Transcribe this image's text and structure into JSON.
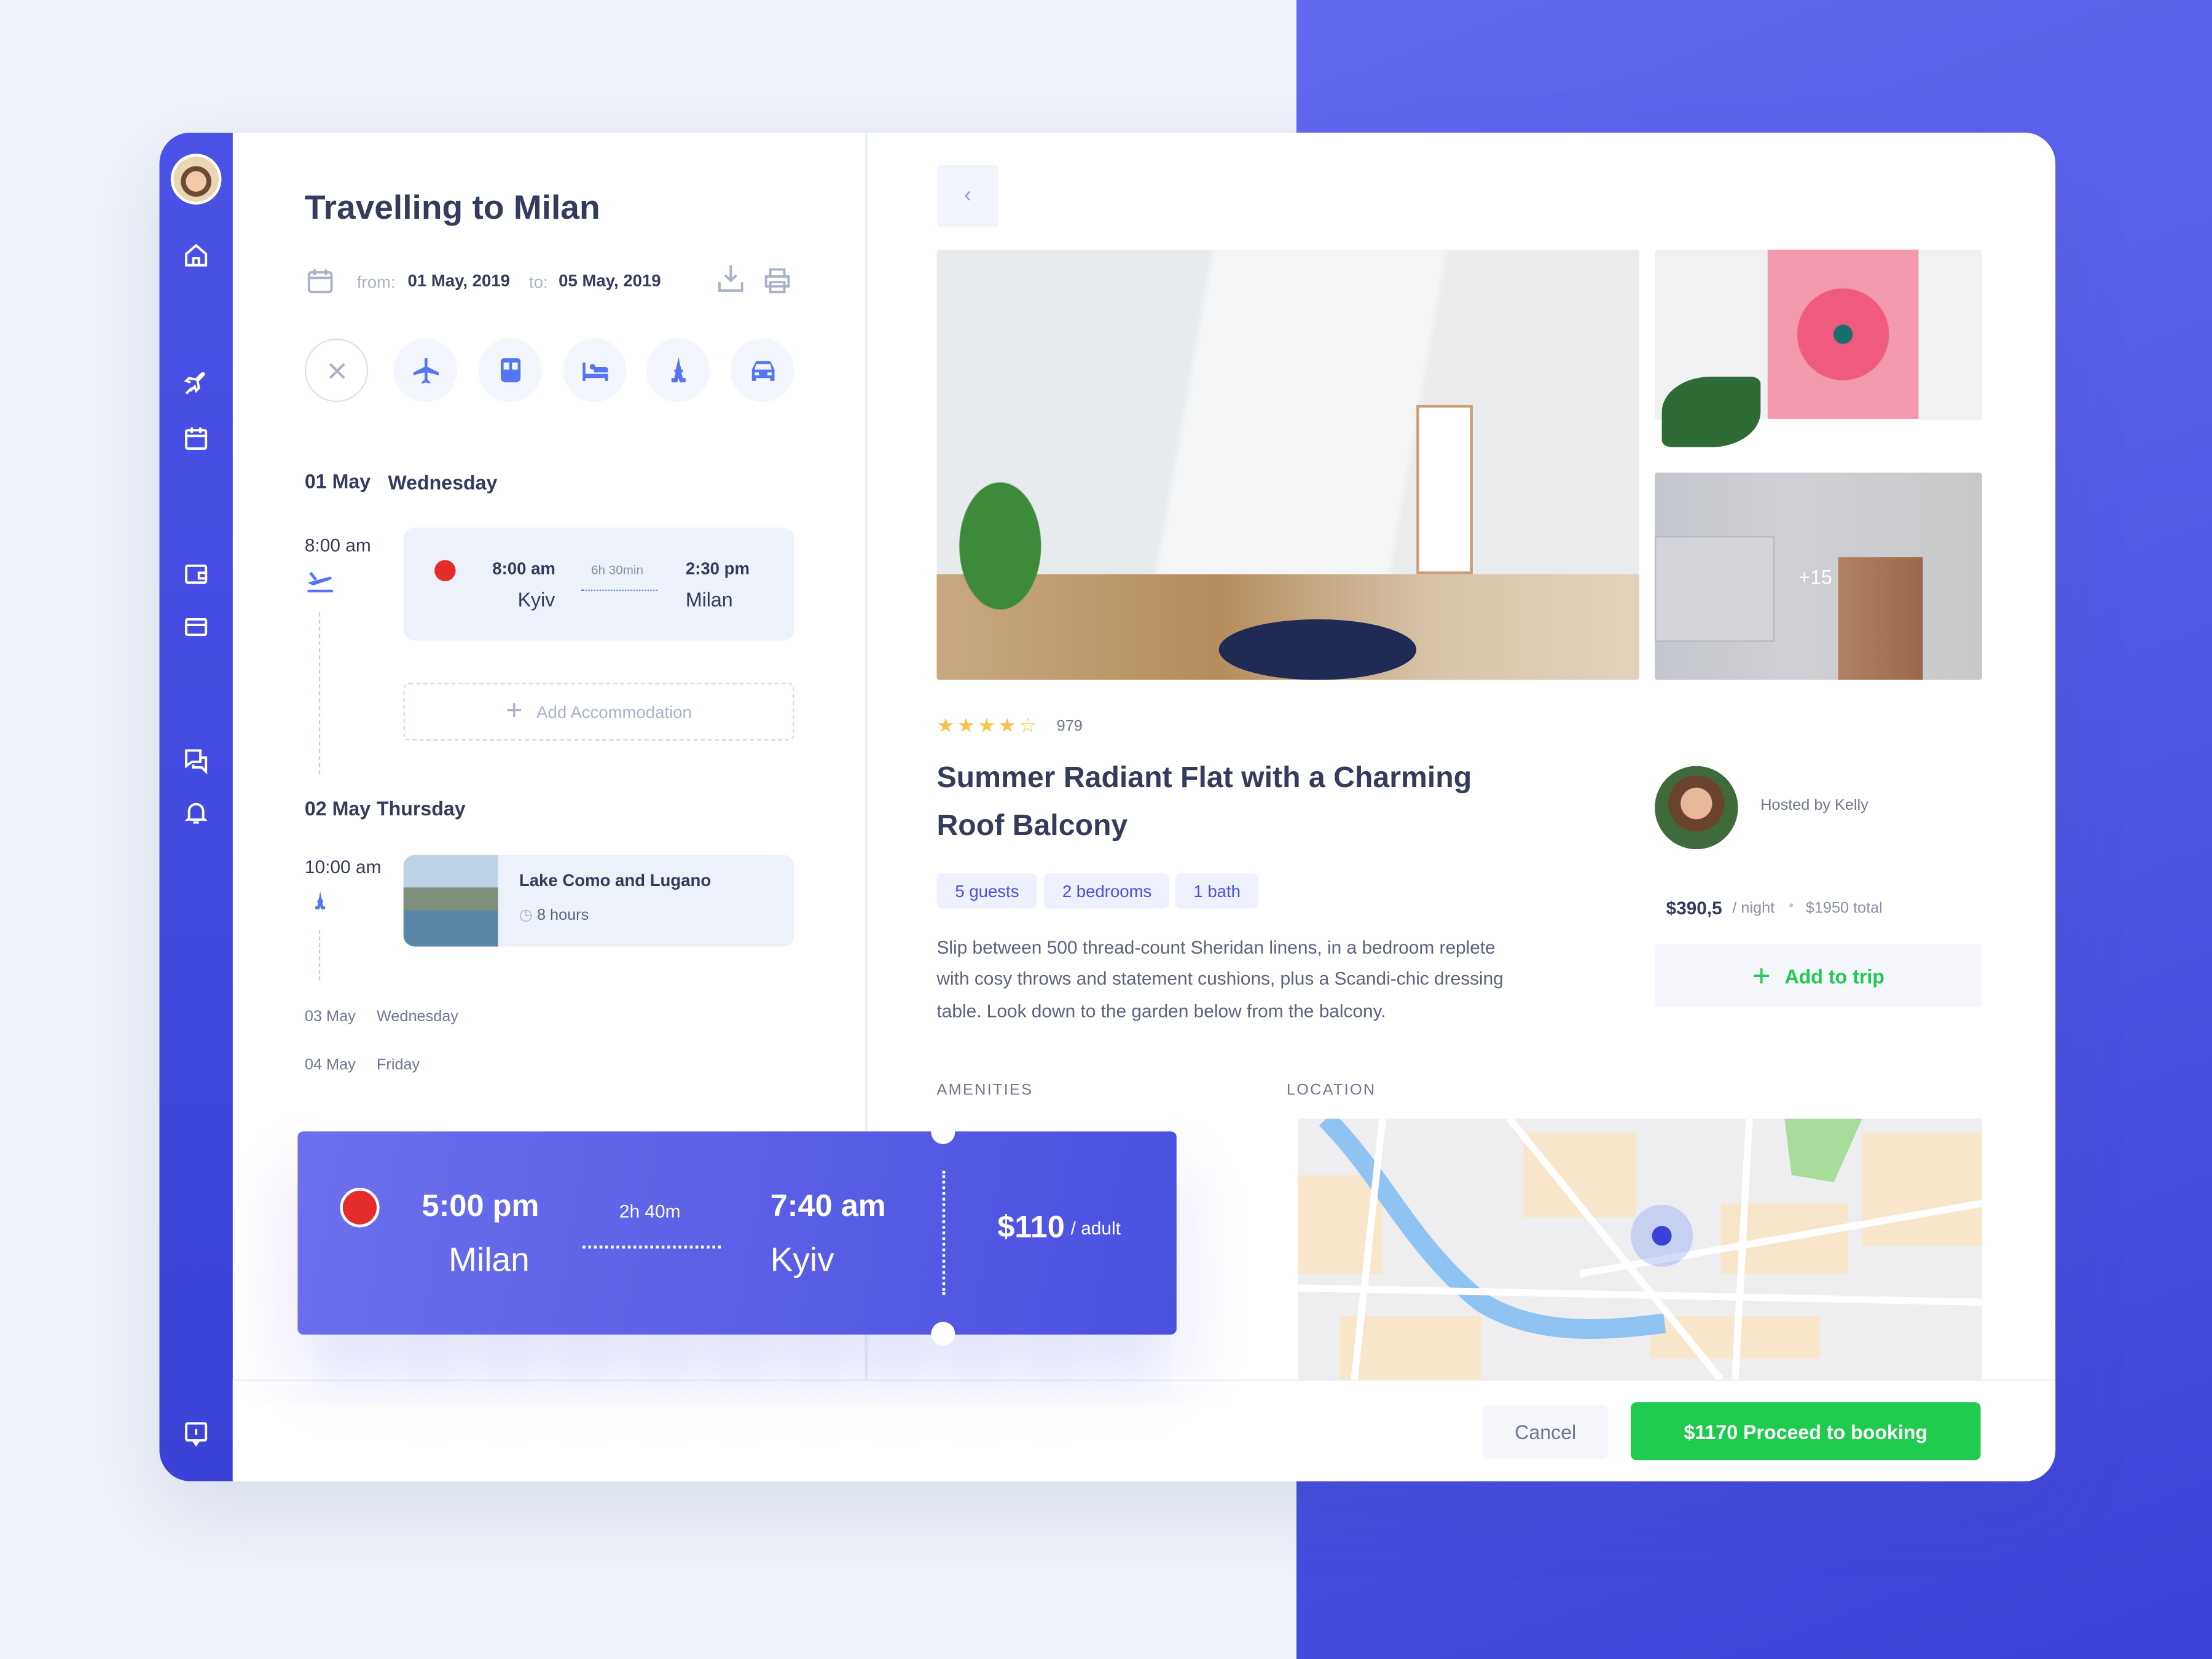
{
  "trip": {
    "title": "Travelling to Milan",
    "from_label": "from:",
    "from_date": "01 May, 2019",
    "to_label": "to:",
    "to_date": "05 May, 2019"
  },
  "days": [
    {
      "date": "01 May",
      "weekday": "Wednesday"
    },
    {
      "date": "02 May",
      "weekday": "Thursday"
    },
    {
      "date": "03 May",
      "weekday": "Wednesday"
    },
    {
      "date": "04 May",
      "weekday": "Friday"
    }
  ],
  "flight1": {
    "time_label": "8:00 am",
    "depart": "8:00 am",
    "from": "Kyiv",
    "duration": "6h 30min",
    "arrive": "2:30 pm",
    "to": "Milan"
  },
  "add_accommodation": "Add Accommodation",
  "excursion": {
    "time_label": "10:00 am",
    "title": "Lake Como and Lugano",
    "duration": "8 hours"
  },
  "ticket": {
    "depart": "5:00 pm",
    "from": "Milan",
    "duration": "2h 40m",
    "arrive": "7:40 am",
    "to": "Kyiv",
    "price": "$110",
    "per": "/ adult"
  },
  "listing": {
    "rating": 4,
    "reviews": "979",
    "title_line1": "Summer Radiant Flat with a Charming",
    "title_line2": "Roof Balcony",
    "chips": [
      "5 guests",
      "2 bedrooms",
      "1 bath"
    ],
    "description": [
      "Slip between 500 thread-count Sheridan linens, in a bedroom replete",
      "with cosy throws and statement cushions, plus a Scandi-chic dressing",
      "table. Look down to the garden below from the balcony."
    ],
    "host": "Hosted by Kelly",
    "price": "$390,5",
    "per_night": "/ night",
    "total": "$1950 total",
    "add_to_trip": "Add to trip",
    "more_photos": "+15",
    "amenities_label": "AMENITIES",
    "location_label": "LOCATION"
  },
  "footer": {
    "cancel": "Cancel",
    "proceed": "$1170 Proceed to booking"
  },
  "colors": {
    "accent": "#4a50e0",
    "green": "#1ecb4f",
    "star": "#fbc34a"
  }
}
